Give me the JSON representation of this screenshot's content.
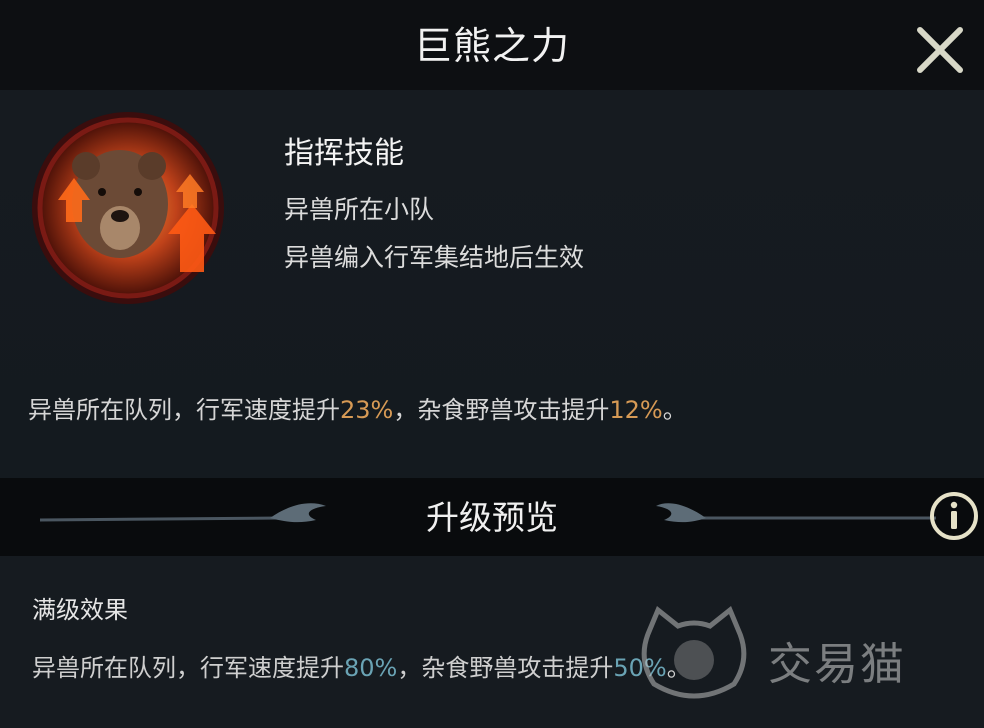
{
  "header": {
    "title": "巨熊之力"
  },
  "skill": {
    "type_label": "指挥技能",
    "condition_1": "异兽所在小队",
    "condition_2": "异兽编入行军集结地后生效",
    "icon": "bear-skill-icon",
    "description": {
      "part1": "异兽所在队列，行军速度提升",
      "value1": "23%",
      "part2": "，杂食野兽攻击提升",
      "value2": "12%",
      "part3": "。"
    }
  },
  "upgrade_preview": {
    "title": "升级预览",
    "max_label": "满级效果",
    "max_description": {
      "part1": "异兽所在队列，行军速度提升",
      "value1": "80%",
      "part2": "，杂食野兽攻击提升",
      "value2": "50%",
      "part3": "。"
    }
  },
  "watermark": {
    "text": "交易猫"
  },
  "colors": {
    "highlight_current": "#d79a55",
    "highlight_max": "#6aa3b4",
    "background": "#12161a"
  }
}
